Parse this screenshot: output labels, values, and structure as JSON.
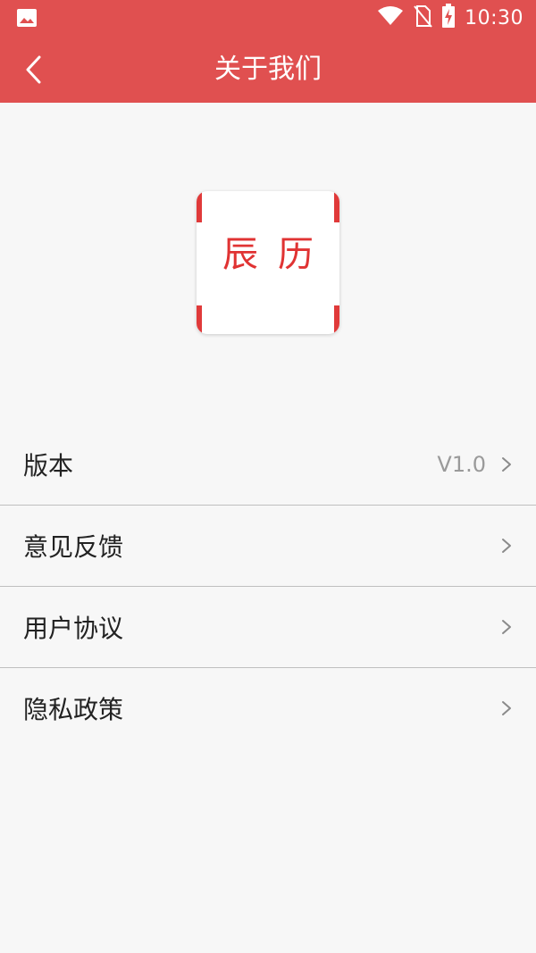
{
  "status_bar": {
    "time": "10:30",
    "icons": [
      "image-notification-icon",
      "wifi-icon",
      "no-sim-icon",
      "battery-charging-icon"
    ]
  },
  "app_bar": {
    "title": "关于我们",
    "back_icon": "chevron-left-icon"
  },
  "logo": {
    "text": "辰历"
  },
  "menu": {
    "items": [
      {
        "label": "版本",
        "value": "V1.0"
      },
      {
        "label": "意见反馈",
        "value": ""
      },
      {
        "label": "用户协议",
        "value": ""
      },
      {
        "label": "隐私政策",
        "value": ""
      }
    ]
  },
  "colors": {
    "primary": "#e05050",
    "logo_red": "#e03333",
    "background": "#f7f7f7"
  }
}
